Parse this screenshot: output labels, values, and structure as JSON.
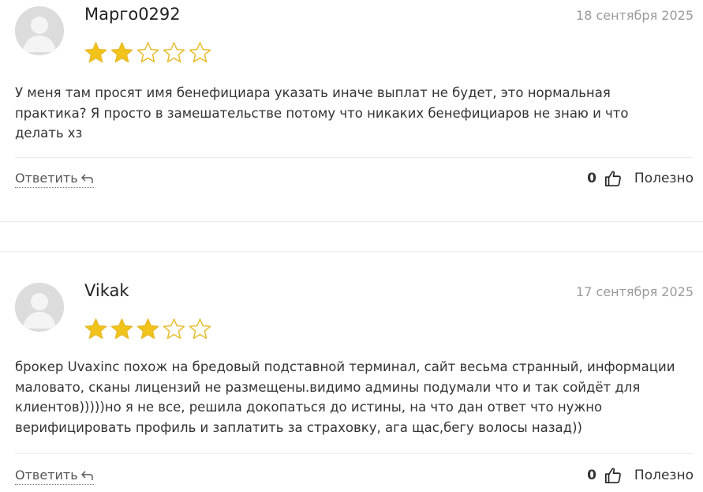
{
  "reviews": [
    {
      "author": "Марго0292",
      "date": "18 сентября 2025",
      "rating": 2,
      "max_rating": 5,
      "text": "У меня там просят имя бенефициара указать иначе выплат не будет, это нормальная практика? Я просто в замешательстве потому что никаких бенефициаров не знаю и что делать хз",
      "reply_label": "Ответить",
      "helpful_count": "0",
      "helpful_label": "Полезно"
    },
    {
      "author": "Vikak",
      "date": "17 сентября 2025",
      "rating": 3,
      "max_rating": 5,
      "text": "брокер Uvaxinc похож на бредовый подставной терминал, сайт весьма странный, информации маловато, сканы лицензий не размещены.видимо админы подумали что и так сойдёт для клиентов)))))но я не все, решила докопаться до истины, на что дан ответ что нужно верифицировать профиль и заплатить за страховку, ага щас,бегу волосы назад))",
      "reply_label": "Ответить",
      "helpful_count": "0",
      "helpful_label": "Полезно"
    }
  ],
  "colors": {
    "star_fill": "#f2c31b",
    "star_outline": "#e8b923",
    "divider": "#ececec"
  },
  "icons": {
    "reply": "reply-arrow-icon",
    "thumb": "thumbs-up-icon",
    "avatar": "user-placeholder-icon"
  }
}
